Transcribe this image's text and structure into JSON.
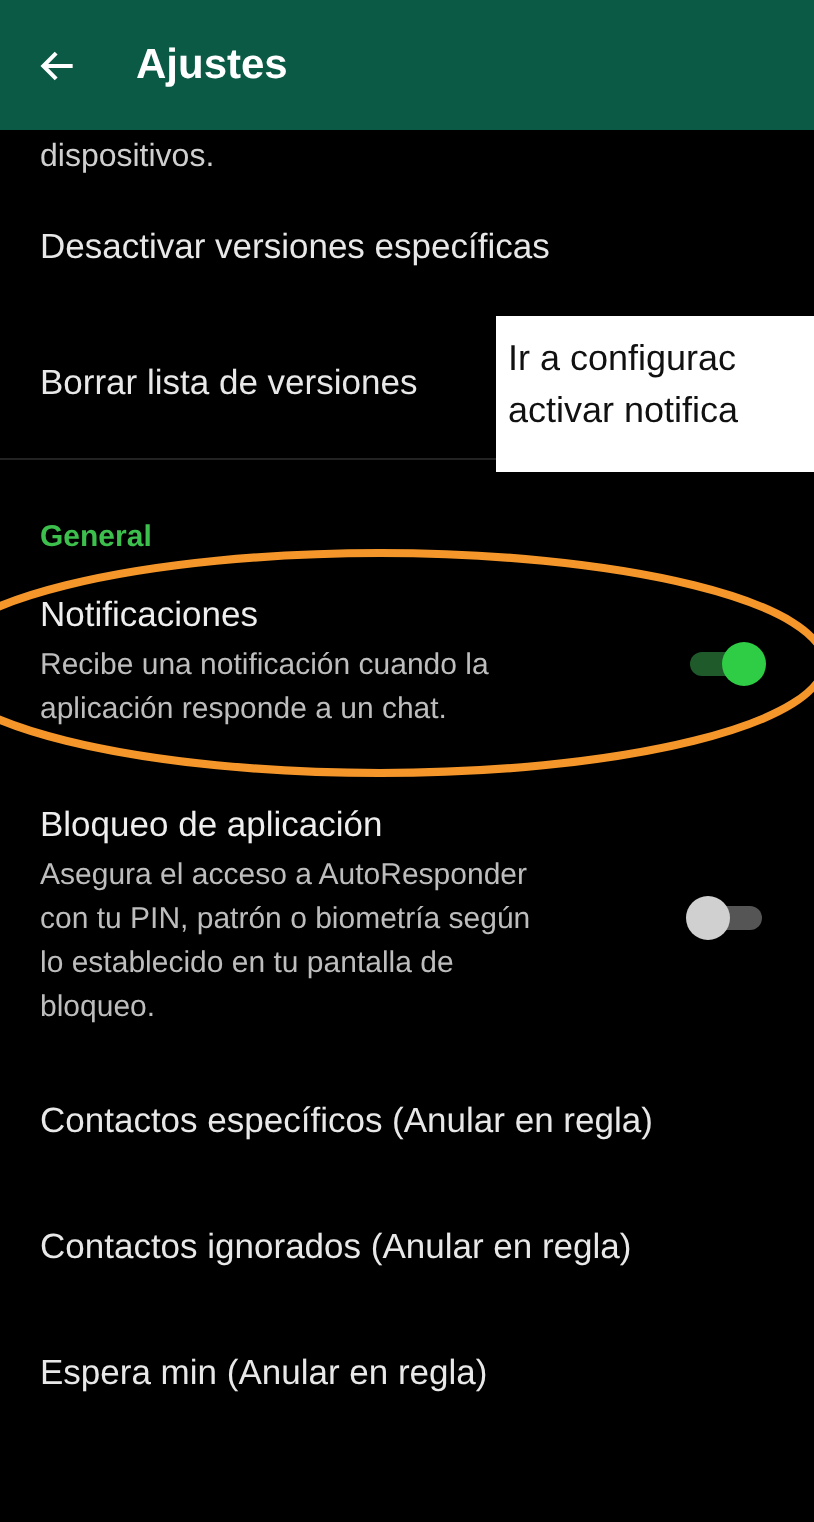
{
  "app_bar": {
    "title": "Ajustes"
  },
  "settings": [
    {
      "kind": "fragment",
      "title": "dispositivos."
    },
    {
      "kind": "plain",
      "title": "Desactivar versiones específicas"
    },
    {
      "kind": "plain",
      "title": "Borrar lista de versiones"
    },
    {
      "kind": "header",
      "title": "General"
    },
    {
      "kind": "switch",
      "title": "Notificaciones",
      "description": "Recibe una notificación cuando la aplicación responde a un chat.",
      "on": true,
      "highlighted": true
    },
    {
      "kind": "switch",
      "title": "Bloqueo de aplicación",
      "description": "Asegura el acceso a AutoResponder con tu PIN, patrón o biometría según lo establecido en tu pantalla de bloqueo.",
      "on": false,
      "highlighted": false
    },
    {
      "kind": "plain",
      "title": "Contactos específicos (Anular en regla)"
    },
    {
      "kind": "plain",
      "title": "Contactos ignorados (Anular en regla)"
    },
    {
      "kind": "plain",
      "title": "Espera min (Anular en regla)"
    }
  ],
  "tooltip": {
    "lines": [
      "Ir a configurac",
      "activar notifica"
    ]
  }
}
